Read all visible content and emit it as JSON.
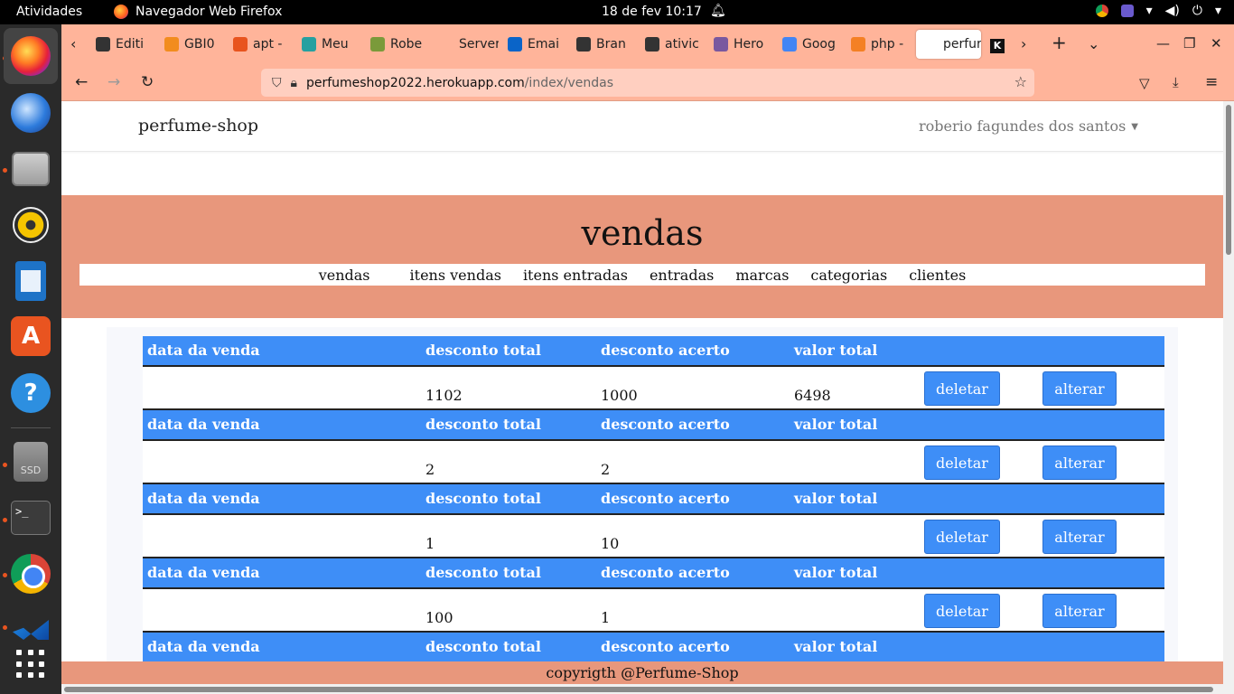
{
  "topbar": {
    "activities": "Atividades",
    "app_name": "Navegador Web Firefox",
    "clock": "18 de fev  10:17"
  },
  "tabs": [
    {
      "label": "Editi",
      "fav": "#333",
      "icon": "github-icon"
    },
    {
      "label": "GBI0",
      "fav": "#f28c1e",
      "icon": "gbi-icon"
    },
    {
      "label": "apt -",
      "fav": "#e8541e",
      "icon": "ask-icon"
    },
    {
      "label": "Meu",
      "fav": "#25a0a0",
      "icon": "meu-icon"
    },
    {
      "label": "Robe",
      "fav": "#7a9a3a",
      "icon": "suap-icon"
    },
    {
      "label": "Server E",
      "fav": "#ffb49a",
      "icon": "server-icon"
    },
    {
      "label": "Emai",
      "fav": "#0a64c8",
      "icon": "outlook-icon"
    },
    {
      "label": "Bran",
      "fav": "#333",
      "icon": "github-icon"
    },
    {
      "label": "ativic",
      "fav": "#333",
      "icon": "github-icon"
    },
    {
      "label": "Hero",
      "fav": "#79589f",
      "icon": "heroku-icon"
    },
    {
      "label": "Goog",
      "fav": "#4285f4",
      "icon": "google-translate-icon"
    },
    {
      "label": "php -",
      "fav": "#f48024",
      "icon": "stackoverflow-icon"
    },
    {
      "label": "perfur",
      "fav": "#fff",
      "icon": "perfume-shop-icon"
    }
  ],
  "urlbar": {
    "host": "perfumeshop2022.herokuapp.com",
    "path": "/index/vendas"
  },
  "site": {
    "brand": "perfume-shop",
    "user": "roberio fagundes dos santos",
    "title": "vendas",
    "menu": [
      "vendas",
      "itens vendas",
      "itens entradas",
      "entradas",
      "marcas",
      "categorias",
      "clientes"
    ]
  },
  "table": {
    "headers": {
      "date": "data da venda",
      "discount_total": "desconto total",
      "discount_fix": "desconto acerto",
      "value_total": "valor total"
    },
    "delete_label": "deletar",
    "edit_label": "alterar",
    "rows": [
      {
        "date": "",
        "discount_total": "1102",
        "discount_fix": "1000",
        "value_total": "6498"
      },
      {
        "date": "",
        "discount_total": "2",
        "discount_fix": "2",
        "value_total": ""
      },
      {
        "date": "",
        "discount_total": "1",
        "discount_fix": "10",
        "value_total": ""
      },
      {
        "date": "",
        "discount_total": "100",
        "discount_fix": "1",
        "value_total": ""
      }
    ]
  },
  "footer": "copyrigth @Perfume-Shop",
  "colors": {
    "accent_blue": "#3e8ef7",
    "salmon": "#e8977c",
    "browser_chrome": "#ffb49a"
  }
}
